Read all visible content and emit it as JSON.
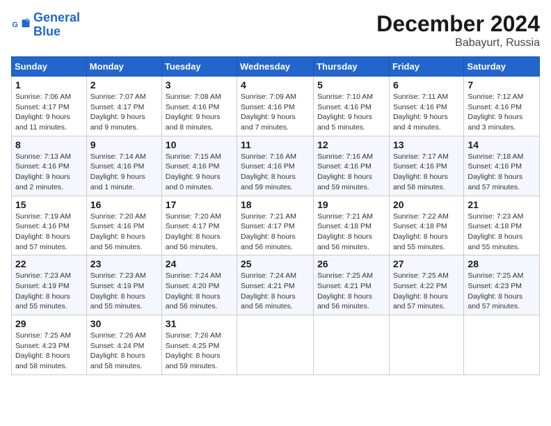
{
  "logo": {
    "line1": "General",
    "line2": "Blue"
  },
  "title": "December 2024",
  "location": "Babayurt, Russia",
  "weekdays": [
    "Sunday",
    "Monday",
    "Tuesday",
    "Wednesday",
    "Thursday",
    "Friday",
    "Saturday"
  ],
  "weeks": [
    [
      {
        "day": "1",
        "sunrise": "7:06 AM",
        "sunset": "4:17 PM",
        "daylight": "9 hours and 11 minutes."
      },
      {
        "day": "2",
        "sunrise": "7:07 AM",
        "sunset": "4:17 PM",
        "daylight": "9 hours and 9 minutes."
      },
      {
        "day": "3",
        "sunrise": "7:08 AM",
        "sunset": "4:16 PM",
        "daylight": "9 hours and 8 minutes."
      },
      {
        "day": "4",
        "sunrise": "7:09 AM",
        "sunset": "4:16 PM",
        "daylight": "9 hours and 7 minutes."
      },
      {
        "day": "5",
        "sunrise": "7:10 AM",
        "sunset": "4:16 PM",
        "daylight": "9 hours and 5 minutes."
      },
      {
        "day": "6",
        "sunrise": "7:11 AM",
        "sunset": "4:16 PM",
        "daylight": "9 hours and 4 minutes."
      },
      {
        "day": "7",
        "sunrise": "7:12 AM",
        "sunset": "4:16 PM",
        "daylight": "9 hours and 3 minutes."
      }
    ],
    [
      {
        "day": "8",
        "sunrise": "7:13 AM",
        "sunset": "4:16 PM",
        "daylight": "9 hours and 2 minutes."
      },
      {
        "day": "9",
        "sunrise": "7:14 AM",
        "sunset": "4:16 PM",
        "daylight": "9 hours and 1 minute."
      },
      {
        "day": "10",
        "sunrise": "7:15 AM",
        "sunset": "4:16 PM",
        "daylight": "9 hours and 0 minutes."
      },
      {
        "day": "11",
        "sunrise": "7:16 AM",
        "sunset": "4:16 PM",
        "daylight": "8 hours and 59 minutes."
      },
      {
        "day": "12",
        "sunrise": "7:16 AM",
        "sunset": "4:16 PM",
        "daylight": "8 hours and 59 minutes."
      },
      {
        "day": "13",
        "sunrise": "7:17 AM",
        "sunset": "4:16 PM",
        "daylight": "8 hours and 58 minutes."
      },
      {
        "day": "14",
        "sunrise": "7:18 AM",
        "sunset": "4:16 PM",
        "daylight": "8 hours and 57 minutes."
      }
    ],
    [
      {
        "day": "15",
        "sunrise": "7:19 AM",
        "sunset": "4:16 PM",
        "daylight": "8 hours and 57 minutes."
      },
      {
        "day": "16",
        "sunrise": "7:20 AM",
        "sunset": "4:16 PM",
        "daylight": "8 hours and 56 minutes."
      },
      {
        "day": "17",
        "sunrise": "7:20 AM",
        "sunset": "4:17 PM",
        "daylight": "8 hours and 56 minutes."
      },
      {
        "day": "18",
        "sunrise": "7:21 AM",
        "sunset": "4:17 PM",
        "daylight": "8 hours and 56 minutes."
      },
      {
        "day": "19",
        "sunrise": "7:21 AM",
        "sunset": "4:18 PM",
        "daylight": "8 hours and 56 minutes."
      },
      {
        "day": "20",
        "sunrise": "7:22 AM",
        "sunset": "4:18 PM",
        "daylight": "8 hours and 55 minutes."
      },
      {
        "day": "21",
        "sunrise": "7:23 AM",
        "sunset": "4:18 PM",
        "daylight": "8 hours and 55 minutes."
      }
    ],
    [
      {
        "day": "22",
        "sunrise": "7:23 AM",
        "sunset": "4:19 PM",
        "daylight": "8 hours and 55 minutes."
      },
      {
        "day": "23",
        "sunrise": "7:23 AM",
        "sunset": "4:19 PM",
        "daylight": "8 hours and 55 minutes."
      },
      {
        "day": "24",
        "sunrise": "7:24 AM",
        "sunset": "4:20 PM",
        "daylight": "8 hours and 56 minutes."
      },
      {
        "day": "25",
        "sunrise": "7:24 AM",
        "sunset": "4:21 PM",
        "daylight": "8 hours and 56 minutes."
      },
      {
        "day": "26",
        "sunrise": "7:25 AM",
        "sunset": "4:21 PM",
        "daylight": "8 hours and 56 minutes."
      },
      {
        "day": "27",
        "sunrise": "7:25 AM",
        "sunset": "4:22 PM",
        "daylight": "8 hours and 57 minutes."
      },
      {
        "day": "28",
        "sunrise": "7:25 AM",
        "sunset": "4:23 PM",
        "daylight": "8 hours and 57 minutes."
      }
    ],
    [
      {
        "day": "29",
        "sunrise": "7:25 AM",
        "sunset": "4:23 PM",
        "daylight": "8 hours and 58 minutes."
      },
      {
        "day": "30",
        "sunrise": "7:26 AM",
        "sunset": "4:24 PM",
        "daylight": "8 hours and 58 minutes."
      },
      {
        "day": "31",
        "sunrise": "7:26 AM",
        "sunset": "4:25 PM",
        "daylight": "8 hours and 59 minutes."
      },
      null,
      null,
      null,
      null
    ]
  ],
  "labels": {
    "sunrise_prefix": "Sunrise: ",
    "sunset_prefix": "Sunset: ",
    "daylight_prefix": "Daylight: "
  }
}
